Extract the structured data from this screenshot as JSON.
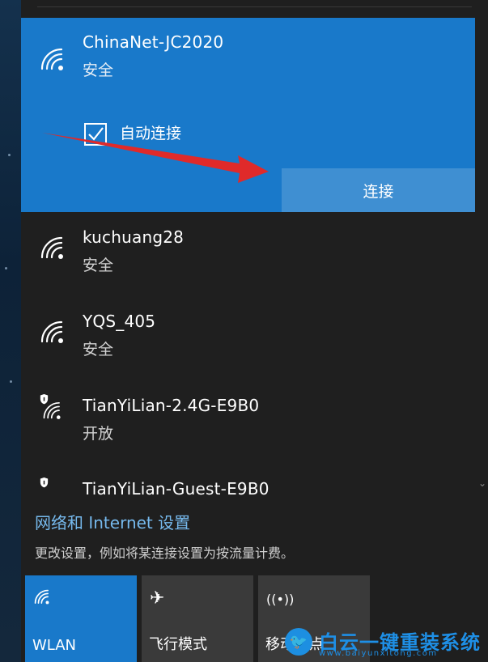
{
  "networks": {
    "selected": {
      "name": "ChinaNet-JC2020",
      "status": "安全",
      "auto_connect_label": "自动连接",
      "auto_connect_checked": true,
      "connect_label": "连接"
    },
    "list": [
      {
        "name": "kuchuang28",
        "status": "安全",
        "icon": "wifi-secured-icon"
      },
      {
        "name": "YQS_405",
        "status": "安全",
        "icon": "wifi-secured-icon"
      },
      {
        "name": "TianYiLian-2.4G-E9B0",
        "status": "开放",
        "icon": "wifi-open-shield-icon"
      },
      {
        "name": "TianYiLian-Guest-E9B0",
        "status": "",
        "icon": "wifi-open-shield-icon"
      }
    ]
  },
  "settings": {
    "link": "网络和 Internet 设置",
    "sub": "更改设置，例如将某连接设置为按流量计费。"
  },
  "quick_actions": [
    {
      "label": "WLAN",
      "icon": "wifi-icon",
      "active": true
    },
    {
      "label": "飞行模式",
      "icon": "airplane-icon",
      "active": false
    },
    {
      "label": "移动热点",
      "icon": "hotspot-icon",
      "active": false
    }
  ],
  "watermark": {
    "title": "白云一键重装系统",
    "url": "www.baiyunxitong.com"
  },
  "colors": {
    "selected_bg": "#1979ca",
    "connect_button": "#3f8fd2",
    "link": "#76b9ed",
    "flyout_bg": "#1f1f1f",
    "annotation_arrow": "#e02a2a"
  }
}
